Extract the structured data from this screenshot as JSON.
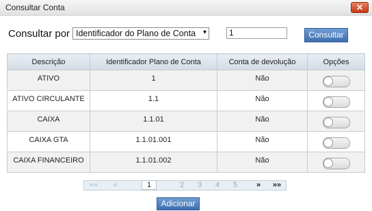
{
  "dialog": {
    "title": "Consultar Conta",
    "close_glyph": "✕"
  },
  "search": {
    "label": "Consultar por",
    "select_value": "Identificador do Plano de Conta",
    "select_arrow": "▾",
    "input_value": "1",
    "button_label": "Consultar"
  },
  "table": {
    "headers": [
      "Descrição",
      "Identificador Plano de Conta",
      "Conta de devolução",
      "Opções"
    ],
    "rows": [
      {
        "descricao": "ATIVO",
        "identificador": "1",
        "devolucao": "Não",
        "toggle_on": false
      },
      {
        "descricao": "ATIVO CIRCULANTE",
        "identificador": "1.1",
        "devolucao": "Não",
        "toggle_on": false
      },
      {
        "descricao": "CAIXA",
        "identificador": "1.1.01",
        "devolucao": "Não",
        "toggle_on": false
      },
      {
        "descricao": "CAIXA GTA",
        "identificador": "1.1.01.001",
        "devolucao": "Não",
        "toggle_on": false
      },
      {
        "descricao": "CAIXA FINANCEIRO",
        "identificador": "1.1.01.002",
        "devolucao": "Não",
        "toggle_on": false
      }
    ]
  },
  "pager": {
    "first": "««",
    "prev": "«",
    "pages": [
      "1",
      "2",
      "3",
      "4",
      "5"
    ],
    "current_page": "1",
    "next": "»",
    "last": "»»"
  },
  "footer": {
    "add_button_label": "Adicionar"
  },
  "colors": {
    "button_blue": "#4a7cbf",
    "close_red": "#d04a27"
  }
}
